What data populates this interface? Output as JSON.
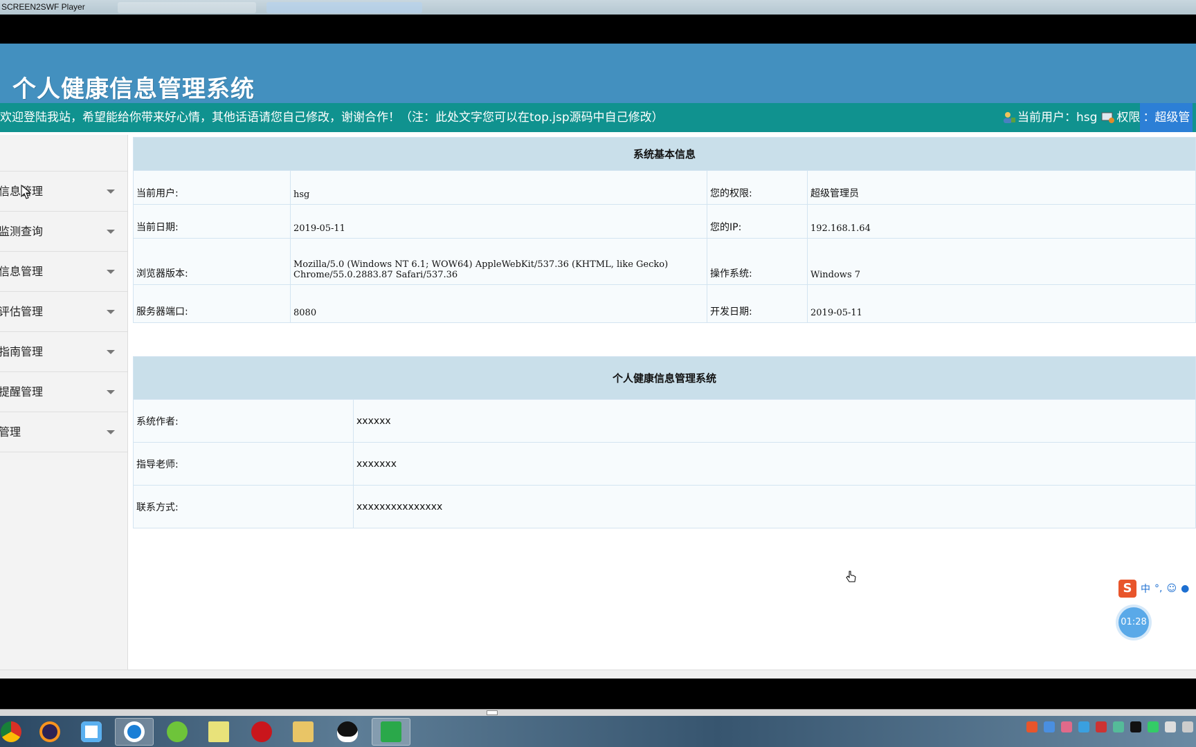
{
  "window": {
    "title": "SCREEN2SWF Player"
  },
  "app": {
    "title": "个人健康信息管理系统",
    "notice": "欢迎登陆我站，希望能给你带来好心情，其他话语请您自己修改，谢谢合作！（注：此处文字您可以在top.jsp源码中自己修改）",
    "current_user_label": "当前用户：hsg",
    "role_label": "权限",
    "role_value": "：超级管"
  },
  "sidebar": {
    "items": [
      {
        "label": "信息管理"
      },
      {
        "label": "监测查询"
      },
      {
        "label": "信息管理"
      },
      {
        "label": "评估管理"
      },
      {
        "label": "指南管理"
      },
      {
        "label": "提醒管理"
      },
      {
        "label": "管理"
      }
    ]
  },
  "sysinfo": {
    "header": "系统基本信息",
    "rows": [
      {
        "k1": "当前用户:",
        "v1": "hsg",
        "k2": "您的权限:",
        "v2": "超级管理员"
      },
      {
        "k1": "当前日期:",
        "v1": "2019-05-11",
        "k2": "您的IP:",
        "v2": "192.168.1.64"
      },
      {
        "k1": "浏览器版本:",
        "v1a": "Mozilla/5.0 (Windows NT 6.1; WOW64) AppleWebKit/537.36 (KHTML, like Gecko)",
        "v1b": "Chrome/55.0.2883.87 Safari/537.36",
        "k2": "操作系统:",
        "v2": "Windows 7"
      },
      {
        "k1": "服务器端口:",
        "v1": "8080",
        "k2": "开发日期:",
        "v2": "2019-05-11"
      }
    ]
  },
  "about": {
    "header": "个人健康信息管理系统",
    "rows": [
      {
        "k": "系统作者:",
        "v": "xxxxxx"
      },
      {
        "k": "指导老师:",
        "v": "xxxxxxx"
      },
      {
        "k": "联系方式:",
        "v": "xxxxxxxxxxxxxxx"
      }
    ]
  },
  "overlay": {
    "timer": "01:28",
    "ime_mode": "中",
    "ime_logo": "S"
  },
  "colors": {
    "banner": "#4390bf",
    "noticebar": "#10928f",
    "table_header": "#c9dfea"
  },
  "taskbar": {
    "apps": [
      "chrome-icon",
      "eclipse-icon",
      "baidu-netdisk-icon",
      "browser-icon",
      "green-app-icon",
      "notepad-icon",
      "flash-icon",
      "file-explorer-icon",
      "qq-icon",
      "screen-recorder-icon"
    ]
  }
}
